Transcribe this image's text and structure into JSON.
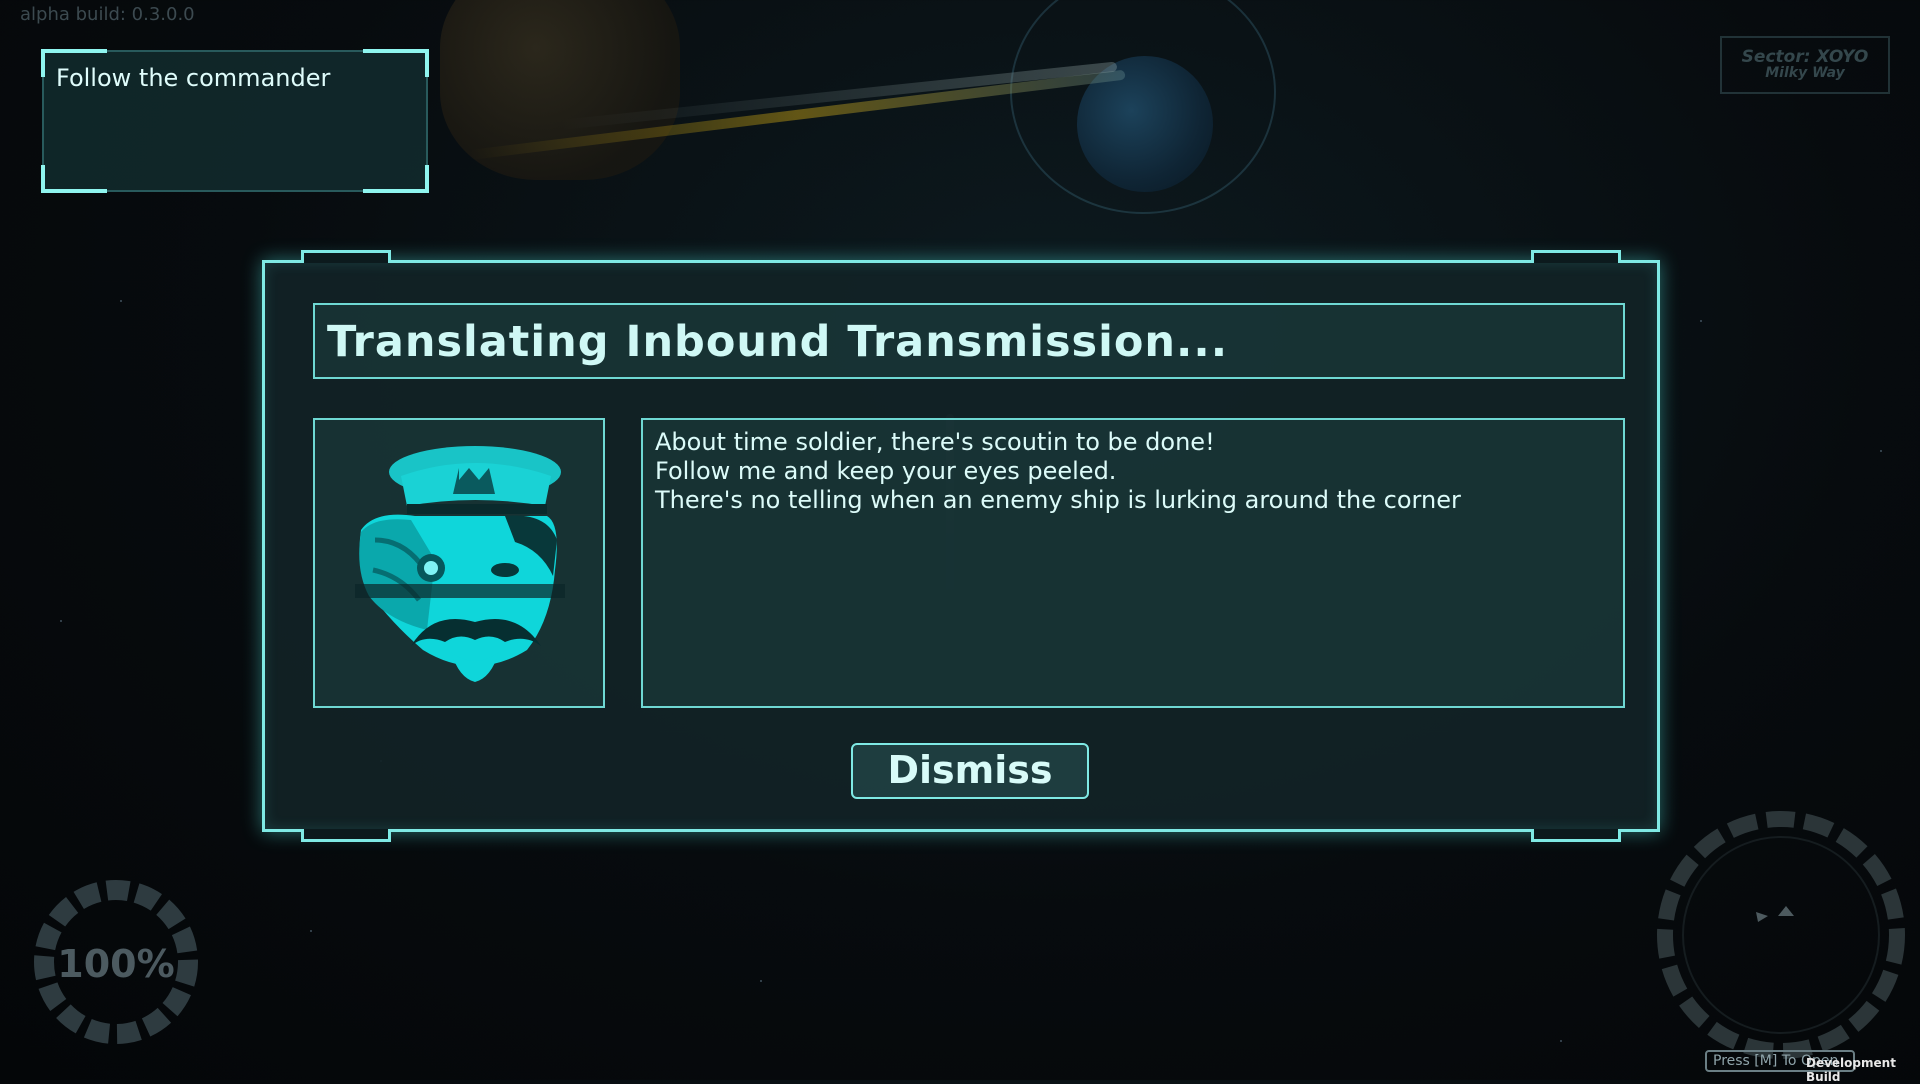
{
  "build_label": "alpha build: 0.3.0.0",
  "objective": {
    "text": "Follow the commander"
  },
  "sector": {
    "name": "Sector: XOYO",
    "region": "Milky Way"
  },
  "dialog": {
    "title": "Translating Inbound Transmission...",
    "message_lines": [
      "About time soldier, there's scoutin to be done!",
      "Follow me and keep your eyes peeled.",
      "There's no telling when an enemy ship is lurking around the corner"
    ],
    "dismiss_label": "Dismiss",
    "portrait_icon": "commander-portrait-icon"
  },
  "hud": {
    "health_percent": "100%",
    "map_hint": "Press [M] To Open",
    "dev_build": "Development Build"
  },
  "colors": {
    "accent": "#7fe9e4",
    "panel": "#122226",
    "portrait": "#19d3d6"
  }
}
